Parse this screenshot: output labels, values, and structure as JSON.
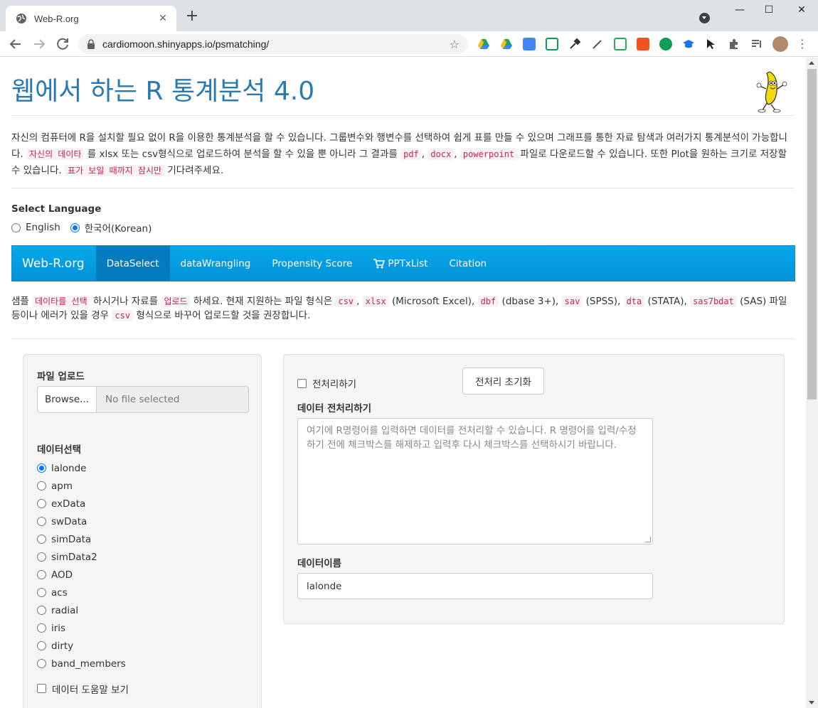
{
  "browser": {
    "tab_title": "Web-R.org",
    "tab_close": "✕",
    "new_tab": "+",
    "url": "cardiomoon.shinyapps.io/psmatching/",
    "window_minimize": "—",
    "window_maximize": "☐",
    "window_close": "✕"
  },
  "header": {
    "title": "웹에서 하는 R 통계분석 4.0"
  },
  "intro": {
    "part1": "자신의 컴퓨터에 R을 설치할 필요 없이 R을 이용한 통계분석을 할 수 있습니다. 그룹변수와 행변수를 선택하여 쉽게 표를 만들 수 있으며 그래프를 통한 자료 탐색과 여러가지 통계분석이 가능합니다. ",
    "code1": "자신의 데이타",
    "part2": " 를 xlsx 또는 csv형식으로 업로드하여 분석을 할 수 있을 뿐 아니라 그 결과를 ",
    "code2": "pdf",
    "sep1": ", ",
    "code3": "docx",
    "sep2": ", ",
    "code4": "powerpoint",
    "part3": " 파일로 다운로드할 수 있습니다. 또한 Plot을 원하는 크기로 저장할 수 있습니다. ",
    "code5": "표가 보일 때까지 잠시만",
    "part4": " 기다려주세요."
  },
  "language": {
    "label": "Select Language",
    "options": [
      "English",
      "한국어(Korean)"
    ],
    "selected": "한국어(Korean)"
  },
  "navbar": {
    "brand": "Web-R.org",
    "items": [
      "DataSelect",
      "dataWrangling",
      "Propensity Score",
      "PPTxList",
      "Citation"
    ],
    "active": "DataSelect"
  },
  "description": {
    "p1": "샘플 ",
    "c1": "데이타를 선택",
    "p2": " 하시거나 자료를 ",
    "c2": "업로드",
    "p3": " 하세요. 현재 지원하는 파일 형식은 ",
    "c3": "csv",
    "p4": ", ",
    "c4": "xlsx",
    "p5": " (Microsoft Excel), ",
    "c5": "dbf",
    "p6": " (dbase 3+), ",
    "c6": "sav",
    "p7": " (SPSS), ",
    "c7": "dta",
    "p8": " (STATA), ",
    "c8": "sas7bdat",
    "p9": " (SAS) 파일 등이나 에러가 있을 경우 ",
    "c9": "csv",
    "p10": " 형식으로 바꾸어 업로드할 것을 권장합니다."
  },
  "sidebar": {
    "upload_label": "파일 업로드",
    "browse_label": "Browse...",
    "file_placeholder": "No file selected",
    "data_label": "데이터선택",
    "datasets": [
      "lalonde",
      "apm",
      "exData",
      "swData",
      "simData",
      "simData2",
      "AOD",
      "acs",
      "radial",
      "iris",
      "dirty",
      "band_members"
    ],
    "selected_dataset": "lalonde",
    "help_checkbox": "데이터 도움말 보기"
  },
  "main": {
    "preprocess_checkbox": "전처리하기",
    "reset_button": "전처리 초기화",
    "preprocess_label": "데이터 전처리하기",
    "preprocess_placeholder": "여기에 R명령어를 입력하면 데이터를 전처리할 수 있습니다. R 명령어를 입력/수정하기 전에 체크박스를 해제하고 입력후 다시 체크박스를 선택하시기 바랍니다.",
    "dataname_label": "데이터이름",
    "dataname_value": "lalonde"
  },
  "colors": {
    "navbar": "#0592d8",
    "navbar_active": "#047bbf",
    "title": "#2a7ab0",
    "code_text": "#c7254e",
    "code_bg": "#f9f2f4",
    "radio_checked": "#0075ff"
  }
}
